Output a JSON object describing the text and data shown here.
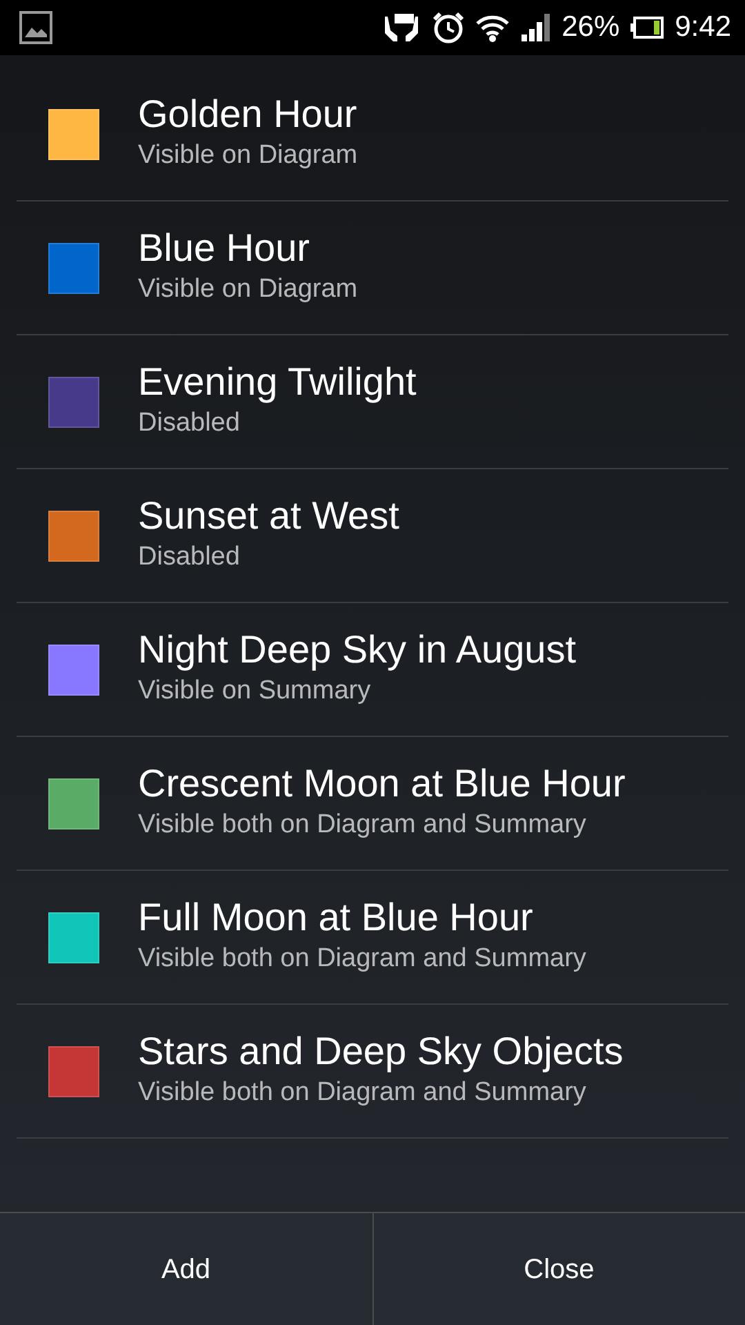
{
  "status_bar": {
    "battery_percent": "26%",
    "time": "9:42"
  },
  "items": [
    {
      "title": "Golden Hour",
      "subtitle": "Visible on Diagram",
      "color": "#ffb744"
    },
    {
      "title": "Blue Hour",
      "subtitle": "Visible on Diagram",
      "color": "#0066cc"
    },
    {
      "title": "Evening Twilight",
      "subtitle": "Disabled",
      "color": "#483a8a"
    },
    {
      "title": "Sunset at West",
      "subtitle": "Disabled",
      "color": "#d2691e"
    },
    {
      "title": "Night Deep Sky in August",
      "subtitle": "Visible on Summary",
      "color": "#8877ff"
    },
    {
      "title": "Crescent Moon at Blue Hour",
      "subtitle": "Visible both on Diagram and Summary",
      "color": "#5aab66"
    },
    {
      "title": "Full Moon at Blue Hour",
      "subtitle": "Visible both on Diagram and Summary",
      "color": "#10c5b8"
    },
    {
      "title": "Stars and Deep Sky Objects",
      "subtitle": "Visible both on Diagram and Summary",
      "color": "#c53636"
    }
  ],
  "buttons": [
    "Add",
    "Close"
  ]
}
